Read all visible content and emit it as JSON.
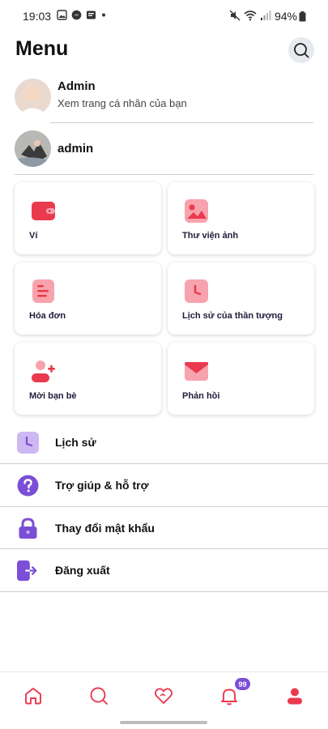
{
  "status_bar": {
    "time": "19:03",
    "battery": "94%"
  },
  "header": {
    "title": "Menu"
  },
  "profiles": [
    {
      "name": "Admin",
      "subtitle": "Xem trang cá nhân của bạn"
    },
    {
      "name": "admin"
    }
  ],
  "grid": [
    {
      "label": "Ví",
      "icon": "wallet-icon"
    },
    {
      "label": "Thư viện ảnh",
      "icon": "image-icon"
    },
    {
      "label": "Hóa đơn",
      "icon": "invoice-icon"
    },
    {
      "label": "Lịch sử của thần tượng",
      "icon": "clock-icon"
    },
    {
      "label": "Mời bạn bè",
      "icon": "add-friend-icon"
    },
    {
      "label": "Phản hồi",
      "icon": "mail-icon"
    }
  ],
  "list": [
    {
      "label": "Lịch sử",
      "icon": "clock-icon"
    },
    {
      "label": "Trợ giúp & hỗ trợ",
      "icon": "help-icon"
    },
    {
      "label": "Thay đổi mật khẩu",
      "icon": "lock-icon"
    },
    {
      "label": "Đăng xuất",
      "icon": "logout-icon"
    }
  ],
  "bottom_nav": {
    "notification_count": "99"
  },
  "colors": {
    "accent_red": "#ea3a4e",
    "accent_purple": "#7a4fd6",
    "soft_pink": "#f7a3ad"
  }
}
